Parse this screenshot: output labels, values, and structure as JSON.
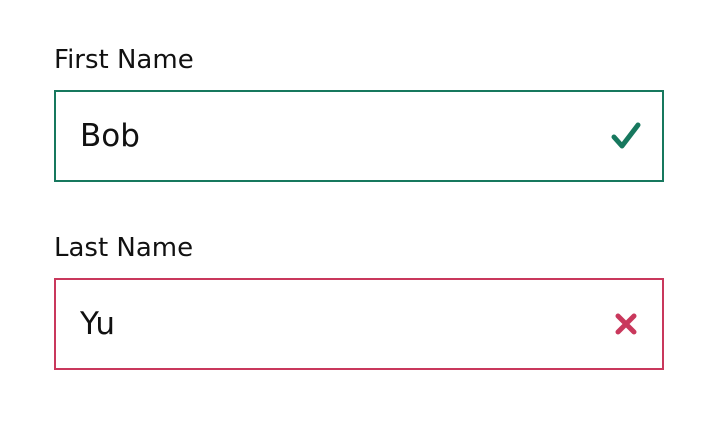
{
  "form": {
    "first_name": {
      "label": "First Name",
      "value": "Bob",
      "status": "valid",
      "icon": "check-icon",
      "color": "#17785e"
    },
    "last_name": {
      "label": "Last Name",
      "value": "Yu",
      "status": "invalid",
      "icon": "cross-icon",
      "color": "#c9385c"
    }
  }
}
